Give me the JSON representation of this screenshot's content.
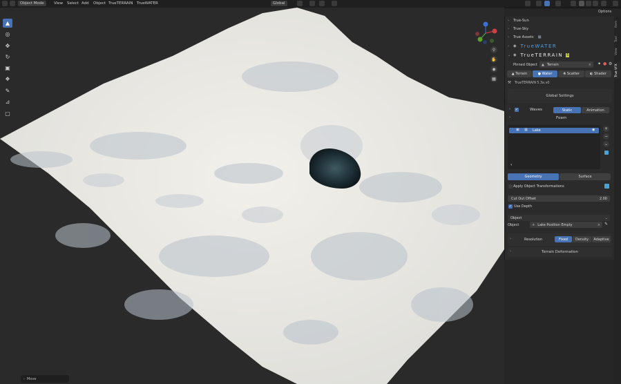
{
  "header": {
    "mode": "Object Mode",
    "menus": [
      "View",
      "Select",
      "Add",
      "Object",
      "TrueTERRAIN",
      "TrueWATER"
    ],
    "orientation": "Global",
    "options_label": "Options"
  },
  "sidebar": {
    "panels": [
      "True-Sun",
      "True-Sky",
      "True Assets"
    ],
    "truewater_logo": "TrueWATER",
    "trueterrain_logo": "TrueTERRAIN",
    "pinned_label": "Pinned Object",
    "pinned_value": "Terrain",
    "tabs": [
      "Terrain",
      "Water",
      "Scatter",
      "Shader"
    ],
    "version": "TrueTERRAIN 5.3a.v0",
    "global_settings": "Global Settings",
    "waves_label": "Waves",
    "waves_options": [
      "Static",
      "Animation"
    ],
    "foam_label": "Foam",
    "list_item": "Lake",
    "geo_tabs": [
      "Geometry",
      "Surface"
    ],
    "apply_transform": "Apply Object Transformations",
    "cut_out_label": "Cut Out Offset",
    "cut_out_value": "2.00",
    "use_depth": "Use Depth",
    "object_select": "Object",
    "object_label": "Object",
    "object_value": "Lake Position Empty",
    "resolution_label": "Resolution",
    "resolution_options": [
      "Fixed",
      "Density",
      "Adaptive"
    ],
    "terrain_deformation": "Terrain Deformation"
  },
  "vtabs": [
    "Item",
    "Tool",
    "View",
    "True VFX"
  ],
  "footer": {
    "operator": "Move"
  },
  "colors": {
    "accent": "#4772b3",
    "panel": "#2b2b2b",
    "viewport": "#2a2a2a"
  }
}
